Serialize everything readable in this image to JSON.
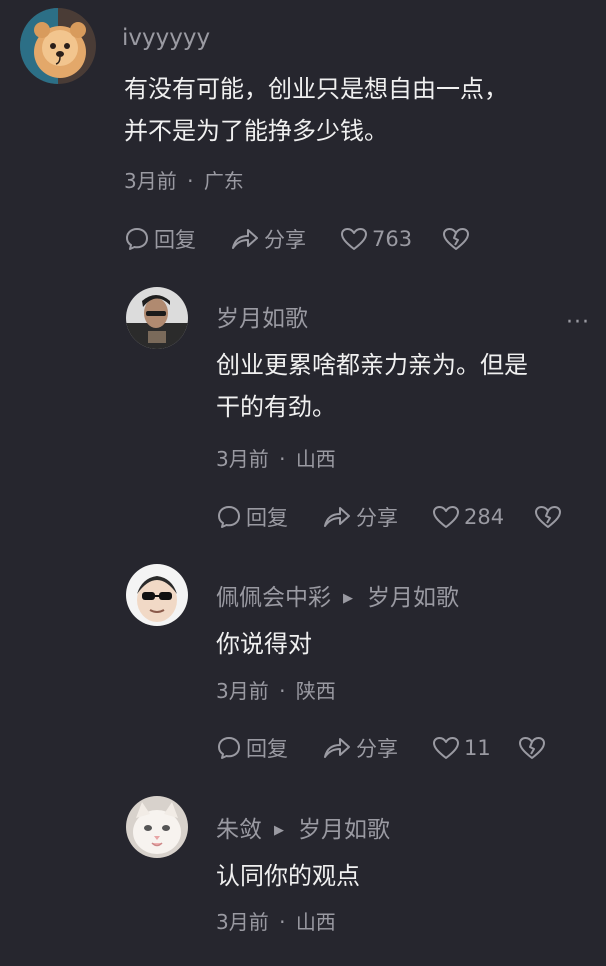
{
  "comments": [
    {
      "username": "ivyyyyy",
      "text_lines": [
        "有没有可能，创业只是想自由一点，",
        "并不是为了能挣多少钱。"
      ],
      "time": "3月前",
      "location": "广东",
      "reply_label": "回复",
      "share_label": "分享",
      "likes": "763"
    },
    {
      "username": "岁月如歌",
      "text_lines": [
        "创业更累啥都亲力亲为。但是",
        "干的有劲。"
      ],
      "time": "3月前",
      "location": "山西",
      "reply_label": "回复",
      "share_label": "分享",
      "likes": "284",
      "more": "···"
    },
    {
      "username": "佩佩会中彩",
      "reply_to": "岁月如歌",
      "text_lines": [
        "你说得对"
      ],
      "time": "3月前",
      "location": "陕西",
      "reply_label": "回复",
      "share_label": "分享",
      "likes": "11"
    },
    {
      "username": "朱敛",
      "reply_to": "岁月如歌",
      "text_lines": [
        "认同你的观点"
      ],
      "time": "3月前",
      "location": "山西"
    }
  ],
  "separator": "·",
  "icons": {
    "reply": "comment-bubble-icon",
    "share": "share-arrow-icon",
    "like": "heart-outline-icon",
    "dislike": "broken-heart-icon",
    "reply_to": "triangle-right-icon"
  },
  "colors": {
    "background": "#26262e",
    "text": "#f0f0f0",
    "muted": "#9a9aa2"
  }
}
